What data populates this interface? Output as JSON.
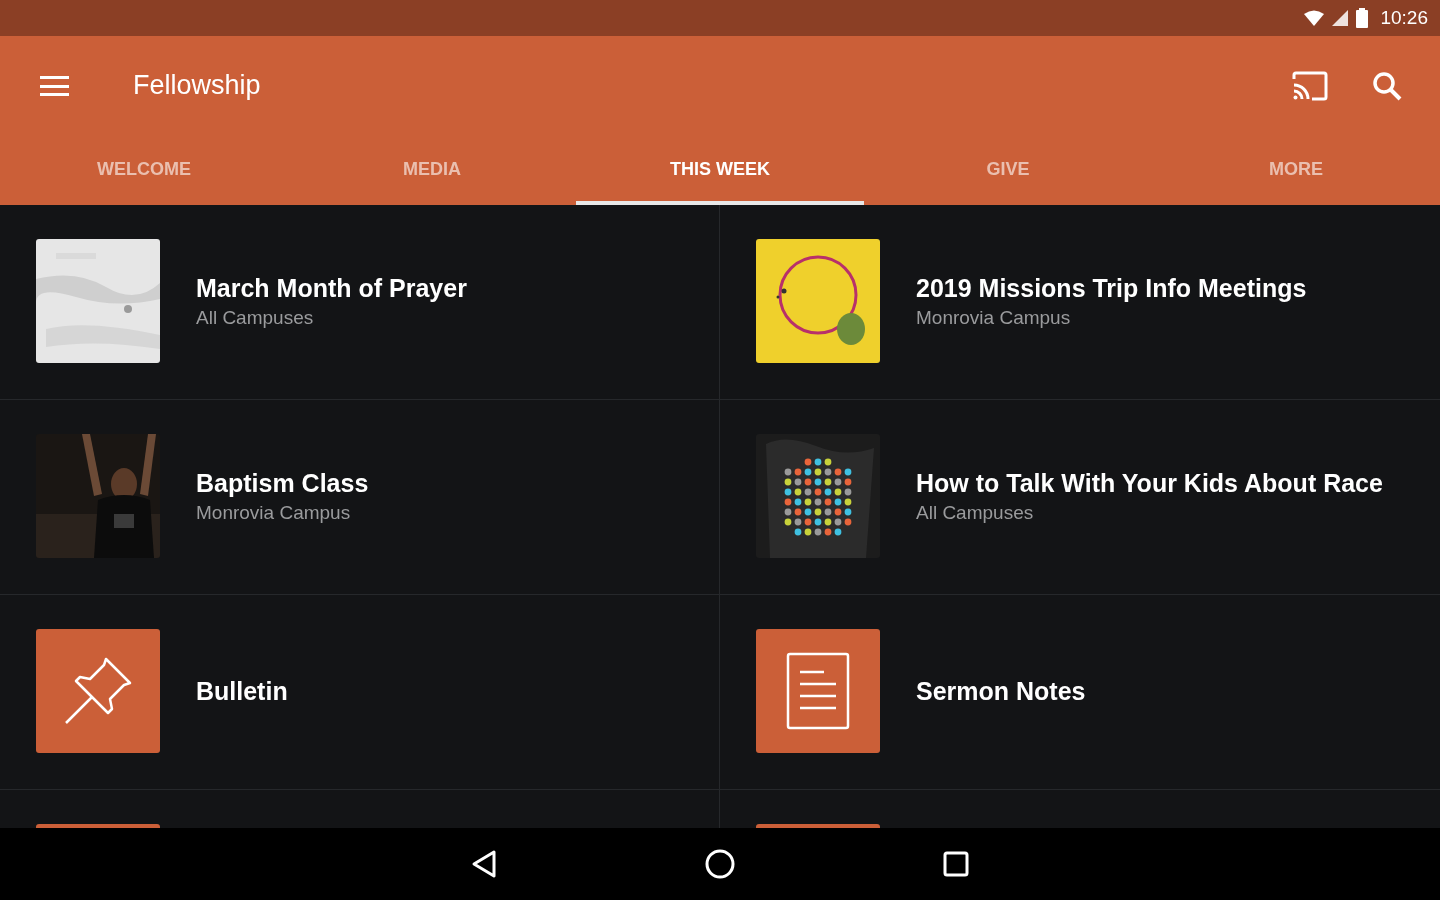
{
  "status_bar": {
    "time": "10:26"
  },
  "app_bar": {
    "title": "Fellowship"
  },
  "tabs": [
    {
      "label": "WELCOME",
      "selected": false
    },
    {
      "label": "MEDIA",
      "selected": false
    },
    {
      "label": "THIS WEEK",
      "selected": true
    },
    {
      "label": "GIVE",
      "selected": false
    },
    {
      "label": "MORE",
      "selected": false
    }
  ],
  "items": [
    {
      "kind": "picture",
      "title": "March Month of Prayer",
      "subtitle": "All Campuses"
    },
    {
      "kind": "picture",
      "title": "2019 Missions Trip Info Meetings",
      "subtitle": "Monrovia Campus"
    },
    {
      "kind": "picture",
      "title": "Baptism Class",
      "subtitle": "Monrovia Campus"
    },
    {
      "kind": "picture",
      "title": "How to Talk With Your Kids About Race",
      "subtitle": "All Campuses"
    },
    {
      "kind": "pin",
      "title": "Bulletin"
    },
    {
      "kind": "document",
      "title": "Sermon Notes"
    },
    {
      "kind": "tile"
    },
    {
      "kind": "tile"
    }
  ]
}
